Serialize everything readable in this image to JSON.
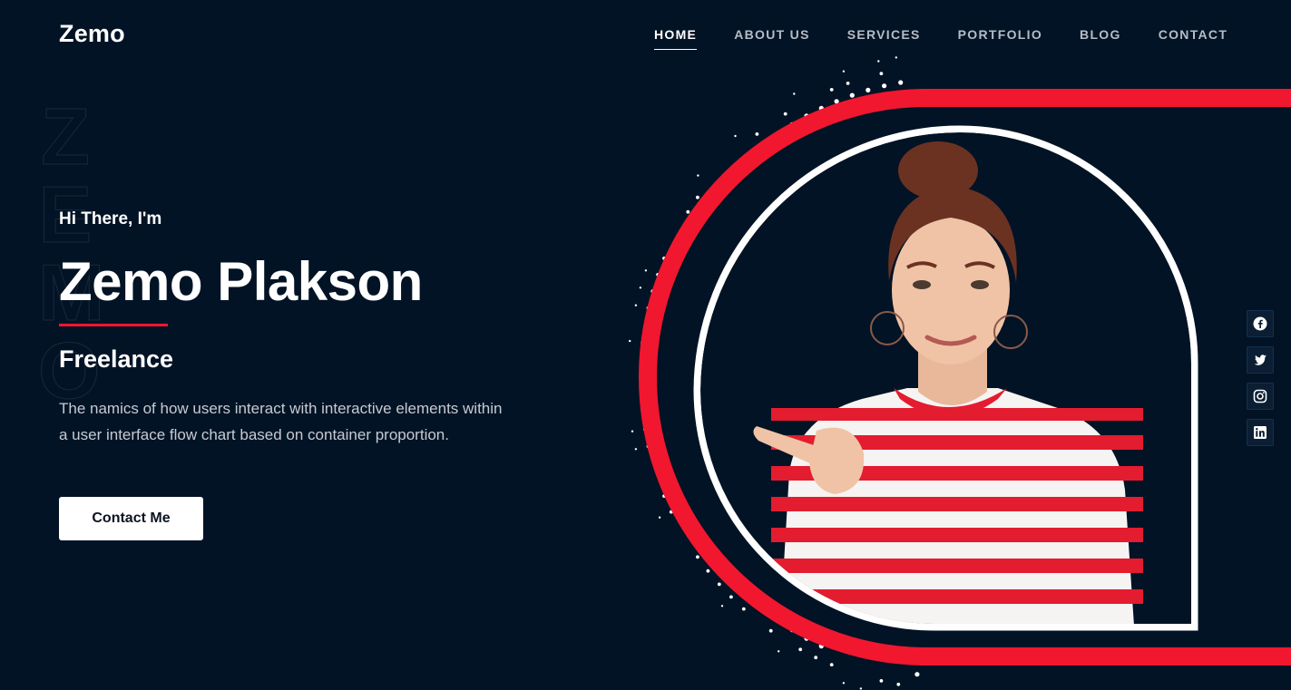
{
  "brand": {
    "logo": "Zemo"
  },
  "nav": {
    "items": [
      {
        "label": "HOME",
        "active": true
      },
      {
        "label": "ABOUT US",
        "active": false
      },
      {
        "label": "SERVICES",
        "active": false
      },
      {
        "label": "PORTFOLIO",
        "active": false
      },
      {
        "label": "BLOG",
        "active": false
      },
      {
        "label": "CONTACT",
        "active": false
      }
    ]
  },
  "hero": {
    "background_word": [
      "Z",
      "E",
      "M",
      "O"
    ],
    "greeting": "Hi There, I'm",
    "name": "Zemo Plakson",
    "role": "Freelance",
    "description": "The namics of how users interact with interactive elements within a user interface flow chart based on container proportion.",
    "cta_label": "Contact Me"
  },
  "social": {
    "icons": [
      "facebook-icon",
      "twitter-icon",
      "instagram-icon",
      "linkedin-icon"
    ]
  },
  "colors": {
    "background": "#021325",
    "accent": "#f0172f",
    "text": "#ffffff",
    "muted_text": "#c5cbd3"
  }
}
